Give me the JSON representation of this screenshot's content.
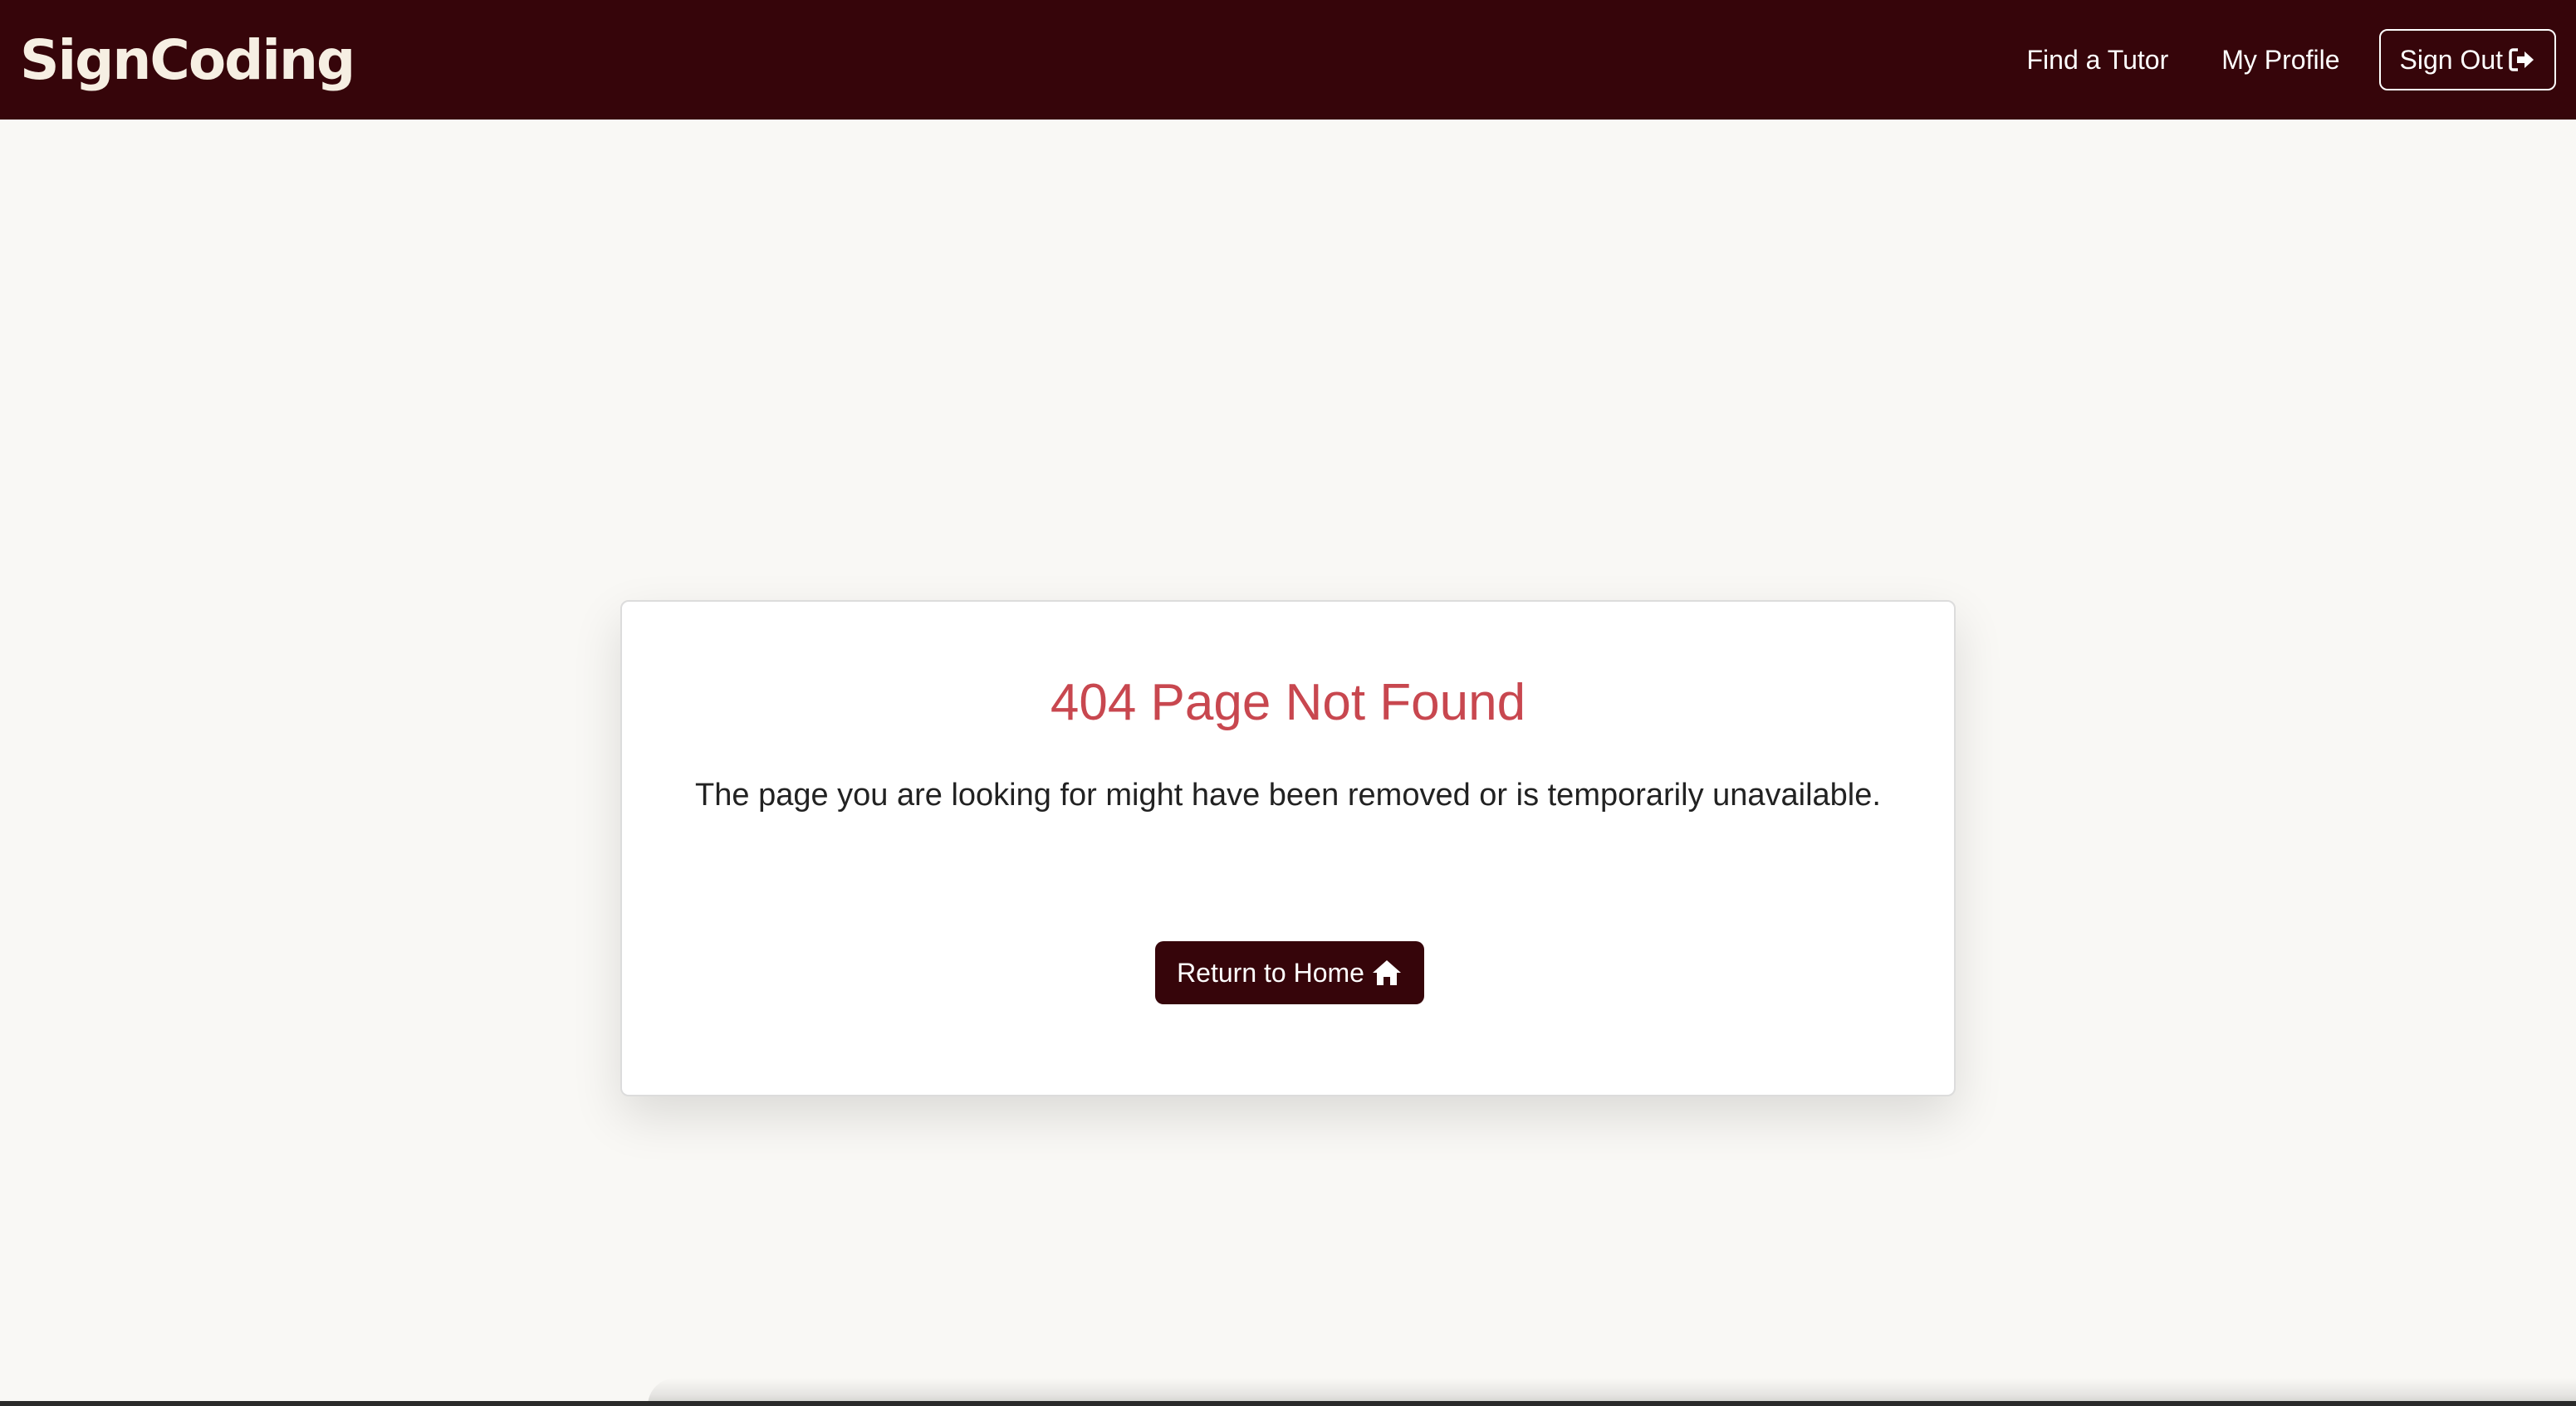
{
  "navbar": {
    "brand": "SignCoding",
    "links": [
      "Find a Tutor",
      "My Profile"
    ],
    "signout_label": "Sign Out",
    "signout_icon": "sign-out-icon"
  },
  "card": {
    "title": "404 Page Not Found",
    "message": "The page you are looking for might have been removed or is temporarily unavailable.",
    "button_label": "Return to Home",
    "button_icon": "home-icon"
  },
  "colors": {
    "brand": "#36050a",
    "background": "#f9f8f5",
    "error_title": "#c8474f"
  }
}
